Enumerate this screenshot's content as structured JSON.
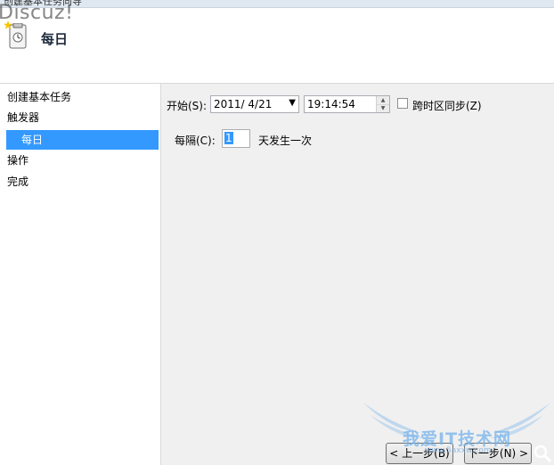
{
  "window": {
    "title": "创建基本任务向导"
  },
  "watermark_text": "Discuz!",
  "header": {
    "title": "每日",
    "icon": "task-icon"
  },
  "nav": {
    "items": [
      {
        "label": "创建基本任务"
      },
      {
        "label": "触发器"
      },
      {
        "label": "每日"
      },
      {
        "label": "操作"
      },
      {
        "label": "完成"
      }
    ]
  },
  "form": {
    "start_label": "开始(S):",
    "start_date": "2011/  4/21",
    "start_time": "19:14:54",
    "sync_label": "跨时区同步(Z)",
    "sync_checked": false,
    "every_label": "每隔(C):",
    "every_value": "1",
    "every_suffix": "天发生一次"
  },
  "buttons": {
    "back": "< 上一步(B)",
    "next": "下一步(N) >"
  },
  "site_watermark": {
    "text": "我爱IT技术网",
    "url": "www.5axxw.com"
  }
}
